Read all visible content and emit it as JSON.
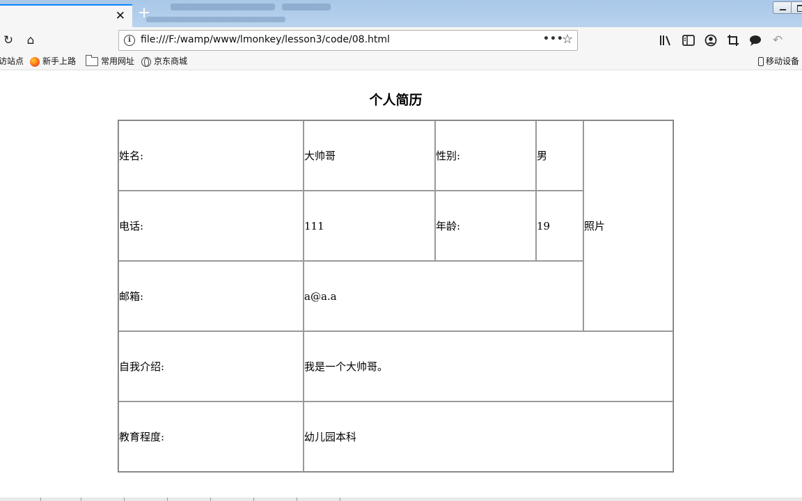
{
  "browser": {
    "tab_close_glyph": "✕",
    "new_tab_glyph": "+",
    "url": "file:///F:/wamp/www/lmonkey/lesson3/code/08.html",
    "url_more_glyph": "•••",
    "url_star_glyph": "☆",
    "info_glyph": "i",
    "reload_glyph": "↻",
    "home_glyph": "⌂",
    "undo_glyph": "↶"
  },
  "bookmarks": {
    "items": [
      {
        "label": "访站点",
        "icon": "none"
      },
      {
        "label": "新手上路",
        "icon": "firefox-icon"
      },
      {
        "label": "常用网址",
        "icon": "folder-icon"
      },
      {
        "label": "京东商城",
        "icon": "globe-icon"
      }
    ],
    "mobile_label": "移动设备"
  },
  "page": {
    "title": "个人简历",
    "rows": {
      "name_label": "姓名:",
      "name_value": "大帅哥",
      "gender_label": "性别:",
      "gender_value": "男",
      "photo": "照片",
      "phone_label": "电话:",
      "phone_value": "111",
      "age_label": "年龄:",
      "age_value": "19",
      "email_label": "邮箱:",
      "email_value": "a@a.a",
      "intro_label": "自我介绍:",
      "intro_value": "我是一个大帅哥。",
      "edu_label": "教育程度:",
      "edu_value": "幼儿园本科"
    }
  },
  "colors": {
    "tab_accent": "#0a84ff",
    "titlebar": "#b9d3ee",
    "toolbar": "#f6f6f7",
    "table_border": "#999999"
  }
}
